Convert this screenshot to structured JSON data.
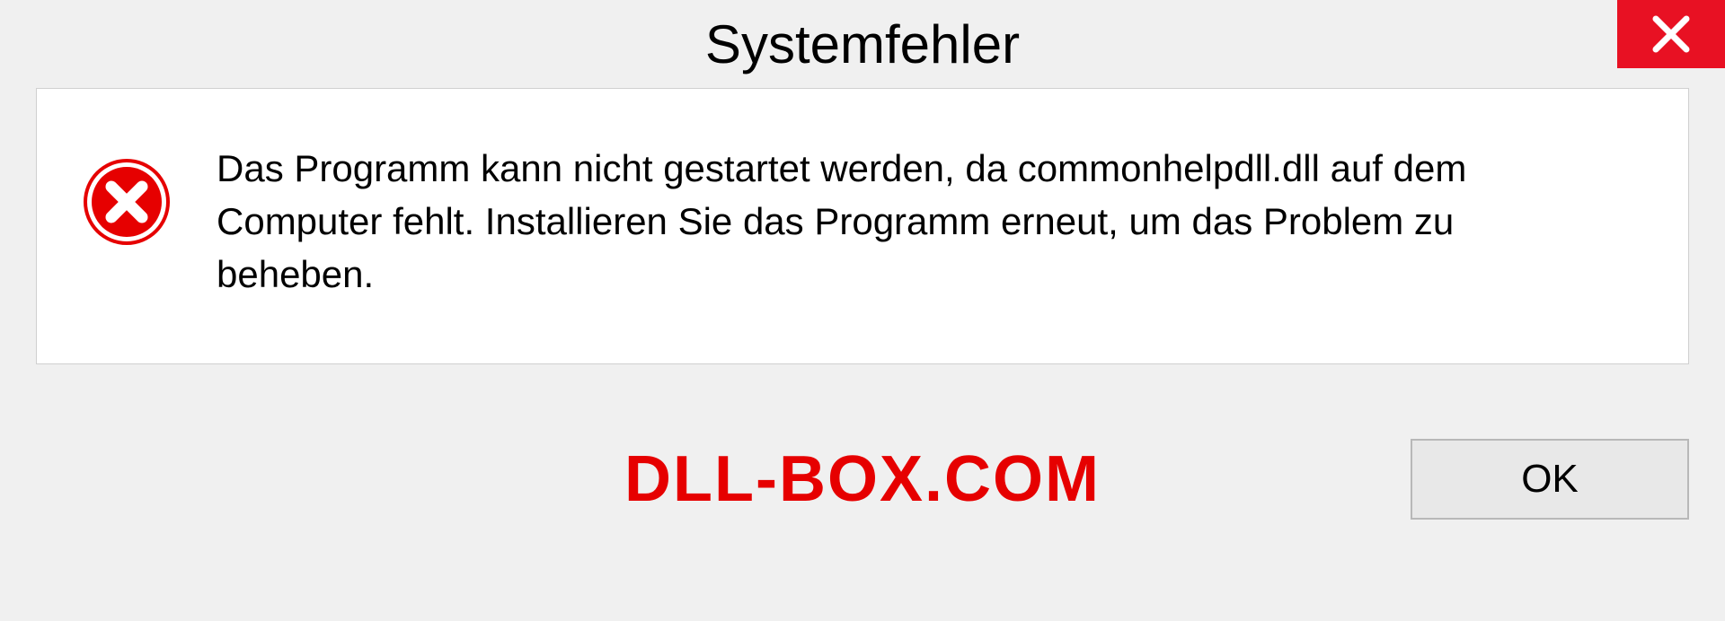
{
  "dialog": {
    "title": "Systemfehler",
    "message": "Das Programm kann nicht gestartet werden, da commonhelpdll.dll auf dem Computer fehlt. Installieren Sie das Programm erneut, um das Problem zu beheben.",
    "ok_button": "OK"
  },
  "watermark": "DLL-BOX.COM"
}
